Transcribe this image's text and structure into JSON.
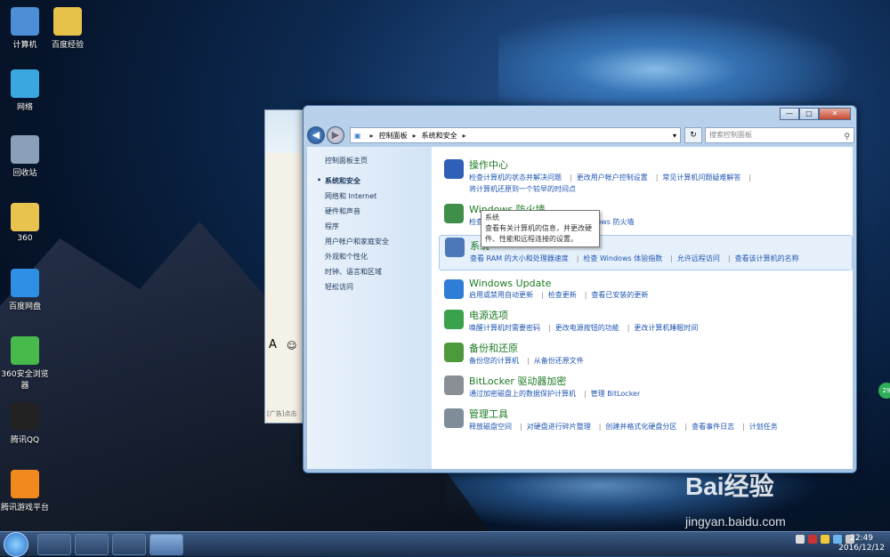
{
  "desktop_icons": [
    {
      "label": "计算机",
      "icon": "computer-icon",
      "color": "#4c8fd6"
    },
    {
      "label": "百度经验",
      "icon": "folder-icon",
      "color": "#e6c24a"
    },
    {
      "label": "网络",
      "icon": "network-icon",
      "color": "#3aa7e0"
    },
    {
      "label": "回收站",
      "icon": "recycle-bin-icon",
      "color": "#8aa0b8"
    },
    {
      "label": "360",
      "icon": "folder-360-icon",
      "color": "#e9c350"
    },
    {
      "label": "百度网盘",
      "icon": "baidu-netdisk-icon",
      "color": "#2e8fe5"
    },
    {
      "label": "360安全浏览器",
      "icon": "browser-360-icon",
      "color": "#48b94b"
    },
    {
      "label": "腾讯QQ",
      "icon": "qq-icon",
      "color": "#222222"
    },
    {
      "label": "腾讯游戏平台",
      "icon": "tencent-games-icon",
      "color": "#f08a1e"
    }
  ],
  "window": {
    "address": {
      "crumbs": [
        "控制面板",
        "系统和安全"
      ]
    },
    "search_placeholder": "搜索控制面板",
    "sidebar": {
      "home": "控制面板主页",
      "items": [
        "系统和安全",
        "网络和 Internet",
        "硬件和声音",
        "程序",
        "用户帐户和家庭安全",
        "外观和个性化",
        "时钟、语言和区域",
        "轻松访问"
      ]
    },
    "categories": [
      {
        "title": "操作中心",
        "icon_color": "#2f5fb7",
        "links": [
          "检查计算机的状态并解决问题",
          "更改用户帐户控制设置",
          "常见计算机问题疑难解答",
          "将计算机还原到一个较早的时间点"
        ]
      },
      {
        "title": "Windows 防火墙",
        "icon_color": "#3f8f4a",
        "links": [
          "检查防火墙状态",
          "允许程序通过 Windows 防火墙"
        ]
      },
      {
        "title": "系统",
        "icon_color": "#4a78b8",
        "links": [
          "查看 RAM 的大小和处理器速度",
          "检查 Windows 体验指数",
          "允许远程访问",
          "查看该计算机的名称"
        ]
      },
      {
        "title": "Windows Update",
        "icon_color": "#2e7dd6",
        "links": [
          "启用或禁用自动更新",
          "检查更新",
          "查看已安装的更新"
        ]
      },
      {
        "title": "电源选项",
        "icon_color": "#3aa14c",
        "links": [
          "唤醒计算机时需要密码",
          "更改电源按钮的功能",
          "更改计算机睡眠时间"
        ]
      },
      {
        "title": "备份和还原",
        "icon_color": "#4d9a3c",
        "links": [
          "备份您的计算机",
          "从备份还原文件"
        ]
      },
      {
        "title": "BitLocker 驱动器加密",
        "icon_color": "#8a8f96",
        "links": [
          "通过加密磁盘上的数据保护计算机",
          "管理 BitLocker"
        ]
      },
      {
        "title": "管理工具",
        "icon_color": "#7f8c9a",
        "links": [
          "释放磁盘空间",
          "对硬盘进行碎片整理",
          "创建并格式化硬盘分区",
          "查看事件日志",
          "计划任务"
        ]
      }
    ],
    "tooltip": {
      "title": "系统",
      "text": "查看有关计算机的信息，并更改硬件、性能和远程连接的设置。"
    }
  },
  "qq_window": {
    "ad_text": "[广告]点击"
  },
  "taskbar": {
    "time": "22:49",
    "date": "2016/12/12"
  },
  "watermark": {
    "brand": "Bai经验",
    "url": "jingyan.baidu.com"
  },
  "badge": "29"
}
